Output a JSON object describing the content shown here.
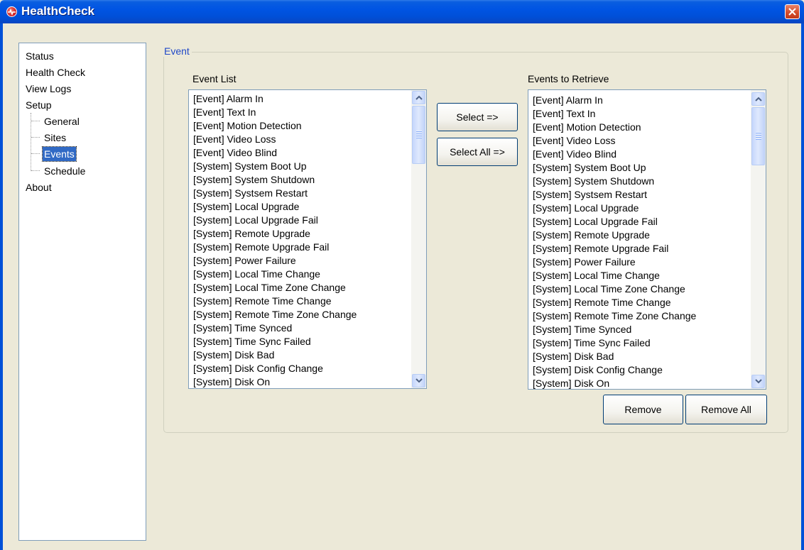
{
  "window": {
    "title": "HealthCheck"
  },
  "tree": {
    "items": [
      {
        "label": "Status"
      },
      {
        "label": "Health Check"
      },
      {
        "label": "View Logs"
      },
      {
        "label": "Setup"
      },
      {
        "label": "General"
      },
      {
        "label": "Sites"
      },
      {
        "label": "Events"
      },
      {
        "label": "Schedule"
      },
      {
        "label": "About"
      }
    ],
    "selected": "Events"
  },
  "group": {
    "legend": "Event"
  },
  "event_list": {
    "label": "Event List",
    "items": [
      "[Event] Alarm In",
      "[Event] Text In",
      "[Event] Motion Detection",
      "[Event] Video Loss",
      "[Event] Video Blind",
      "[System] System Boot Up",
      "[System] System Shutdown",
      "[System] Systsem Restart",
      "[System] Local Upgrade",
      "[System] Local Upgrade Fail",
      "[System] Remote Upgrade",
      "[System] Remote Upgrade Fail",
      "[System] Power Failure",
      "[System] Local Time Change",
      "[System] Local Time Zone Change",
      "[System] Remote Time Change",
      "[System] Remote Time Zone Change",
      "[System] Time Synced",
      "[System] Time Sync Failed",
      "[System] Disk Bad",
      "[System] Disk Config Change",
      "[System] Disk On"
    ]
  },
  "retrieve_list": {
    "label": "Events to Retrieve",
    "items": [
      "[Event] Alarm In",
      "[Event] Text In",
      "[Event] Motion Detection",
      "[Event] Video Loss",
      "[Event] Video Blind",
      "[System] System Boot Up",
      "[System] System Shutdown",
      "[System] Systsem Restart",
      "[System] Local Upgrade",
      "[System] Local Upgrade Fail",
      "[System] Remote Upgrade",
      "[System] Remote Upgrade Fail",
      "[System] Power Failure",
      "[System] Local Time Change",
      "[System] Local Time Zone Change",
      "[System] Remote Time Change",
      "[System] Remote Time Zone Change",
      "[System] Time Synced",
      "[System] Time Sync Failed",
      "[System] Disk Bad",
      "[System] Disk Config Change",
      "[System] Disk On"
    ]
  },
  "buttons": {
    "select": "Select =>",
    "select_all": "Select All =>",
    "remove": "Remove",
    "remove_all": "Remove All"
  },
  "colors": {
    "titlebar": "#0054e3",
    "selection": "#316ac5",
    "legend_text": "#2149c8",
    "window_bg": "#ece9d8"
  },
  "icons": [
    "app-icon",
    "close-icon",
    "scroll-up-icon",
    "scroll-down-icon"
  ]
}
